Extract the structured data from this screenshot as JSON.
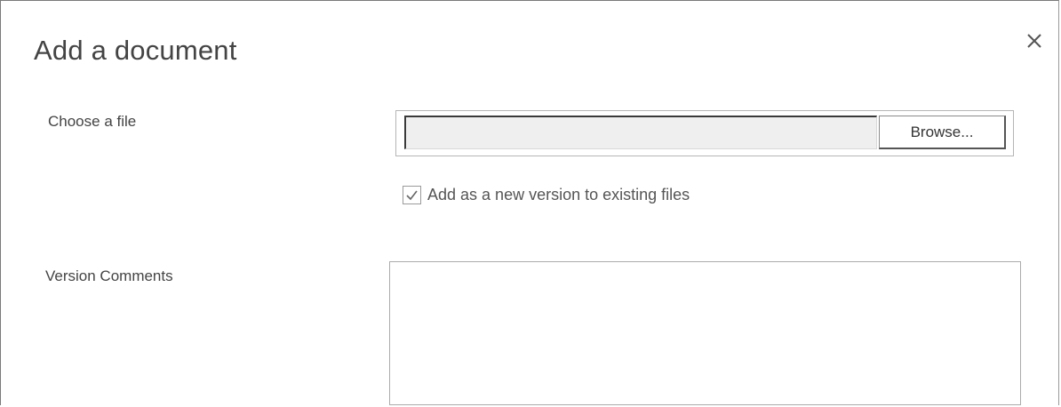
{
  "dialog": {
    "title": "Add a document",
    "close_icon": "close-icon"
  },
  "file_field": {
    "label": "Choose a file",
    "value": "",
    "browse_label": "Browse..."
  },
  "version_option": {
    "label": "Add as a new version to existing files",
    "checked": true
  },
  "comments_field": {
    "label": "Version Comments",
    "value": ""
  }
}
